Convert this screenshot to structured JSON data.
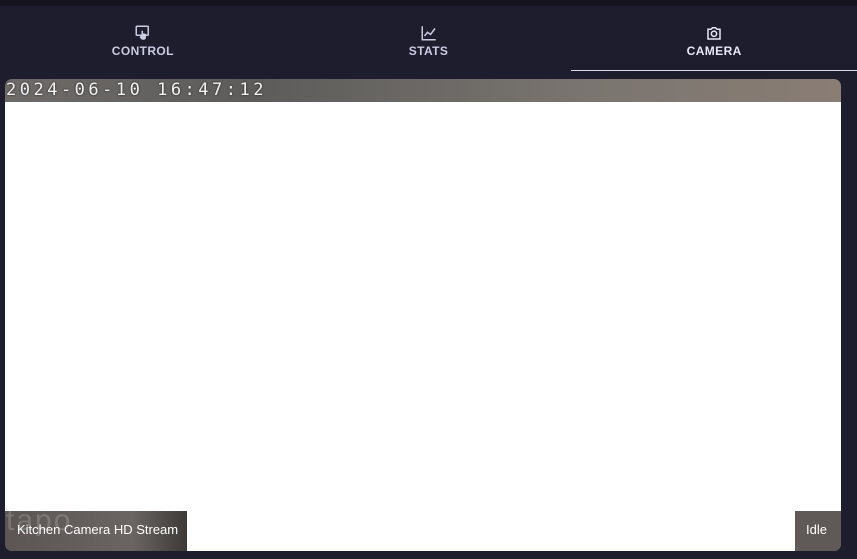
{
  "tabs": [
    {
      "label": "CONTROL",
      "icon": "touch-screen-icon",
      "active": false
    },
    {
      "label": "STATS",
      "icon": "line-chart-icon",
      "active": false
    },
    {
      "label": "CAMERA",
      "icon": "camera-icon",
      "active": true
    }
  ],
  "camera": {
    "timestamp": "2024-06-10 16:47:12",
    "stream_name": "Kitchen Camera HD Stream",
    "status": "Idle",
    "watermark": "tapo"
  },
  "colors": {
    "background": "#1e1d2d",
    "tab_text": "#c9cbe0",
    "active_indicator": "#d8dae8"
  }
}
